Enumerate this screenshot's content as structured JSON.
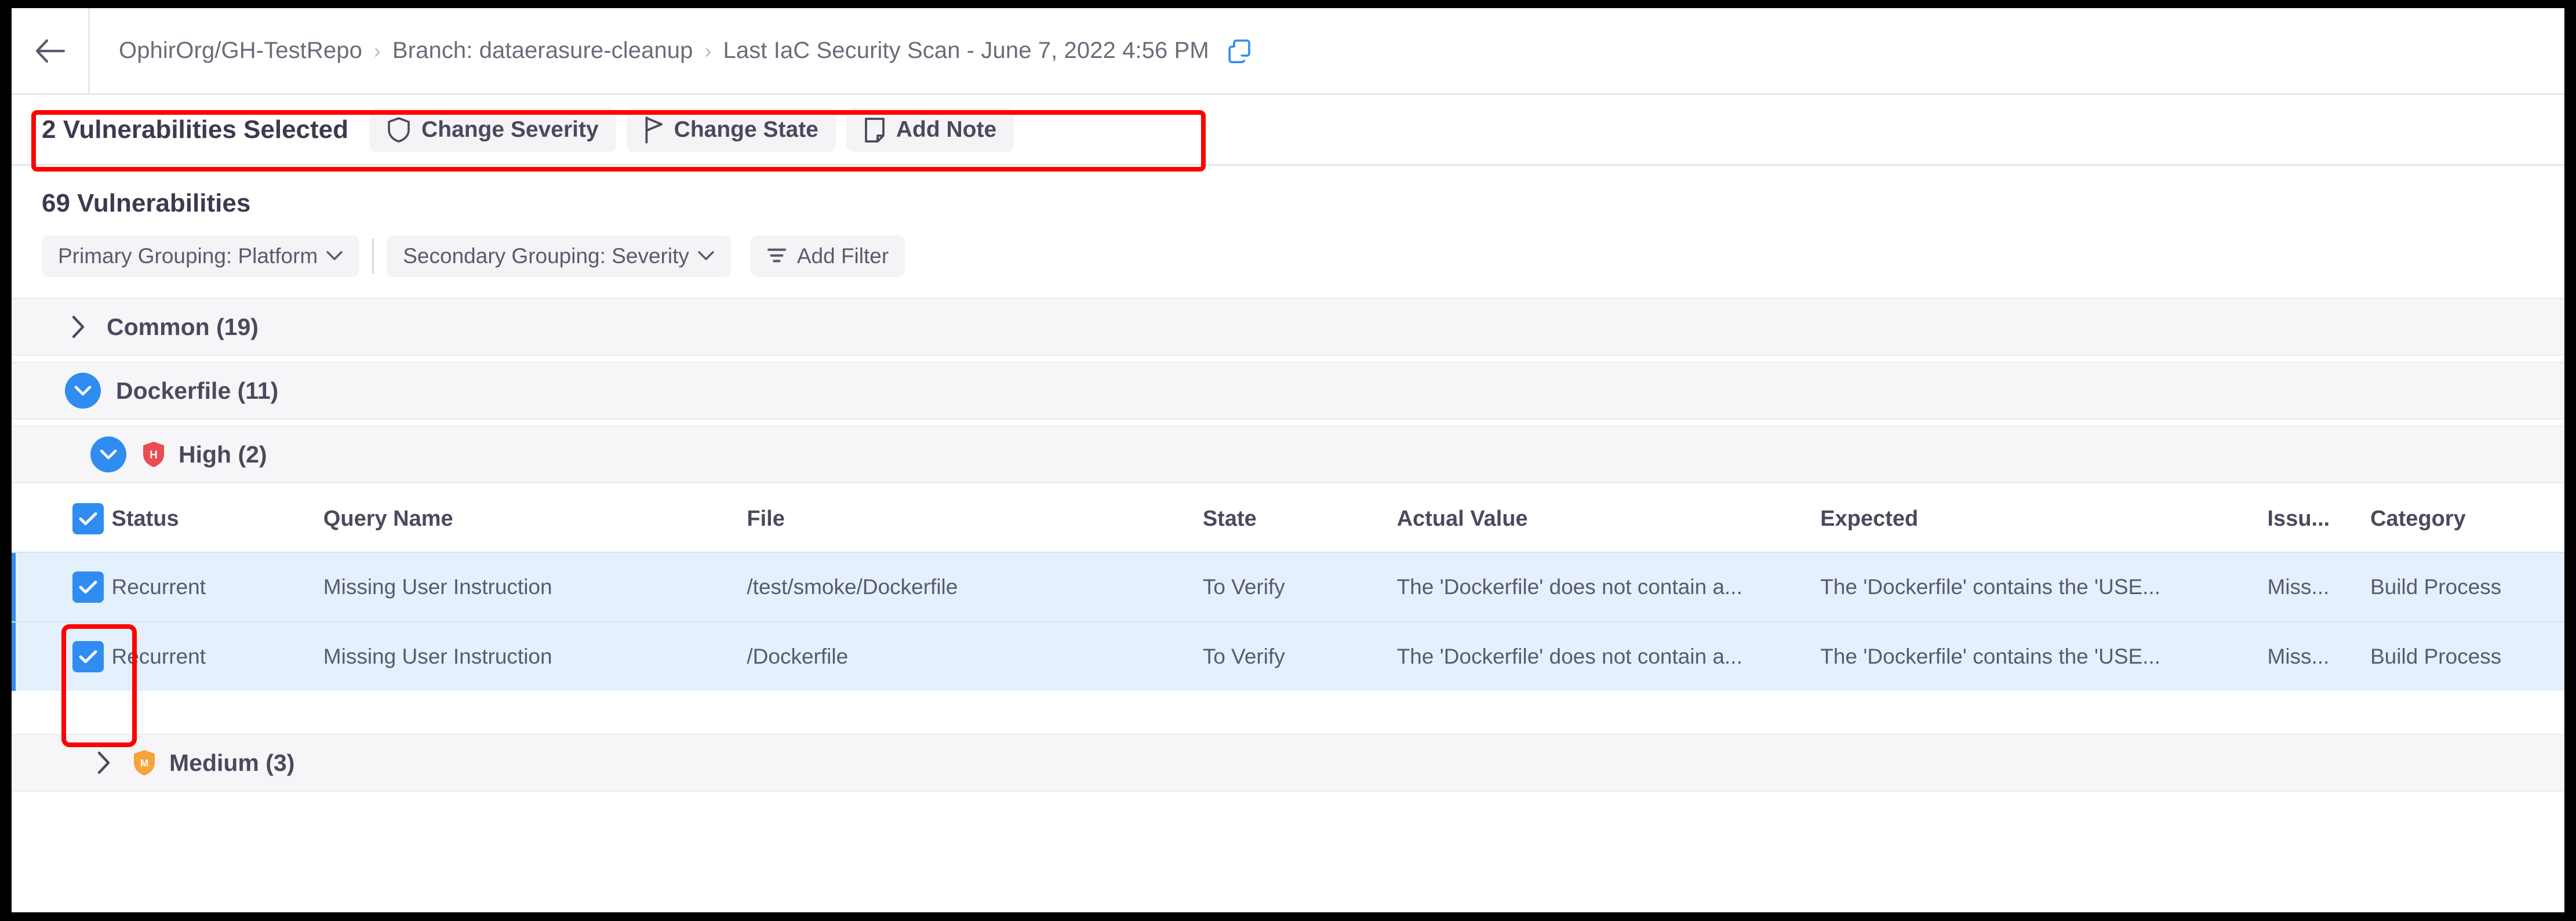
{
  "breadcrumb": {
    "back_icon": "arrow-left-icon",
    "items": [
      {
        "label": "OphirOrg/GH-TestRepo"
      },
      {
        "label": "Branch: dataerasure-cleanup"
      },
      {
        "label": "Last IaC Security Scan - June 7, 2022 4:56 PM"
      }
    ],
    "separator": "›",
    "copy_icon": "copy-icon"
  },
  "action_bar": {
    "selection_count_label": "2 Vulnerabilities Selected",
    "buttons": [
      {
        "label": "Change Severity",
        "icon": "shield-icon"
      },
      {
        "label": "Change State",
        "icon": "flag-icon"
      },
      {
        "label": "Add Note",
        "icon": "note-icon"
      }
    ]
  },
  "list_header": {
    "count_label": "69 Vulnerabilities",
    "primary_grouping": "Primary Grouping: Platform",
    "secondary_grouping": "Secondary Grouping: Severity",
    "add_filter": "Add Filter",
    "chevron": "⌄"
  },
  "groups": [
    {
      "label": "Common (19)",
      "expanded": false
    },
    {
      "label": "Dockerfile (11)",
      "expanded": true
    }
  ],
  "severity_groups": [
    {
      "label": "High (2)",
      "severity": "High",
      "letter": "H",
      "color": "#ea4c53",
      "expanded": true
    },
    {
      "label": "Medium (3)",
      "severity": "Medium",
      "letter": "M",
      "color": "#f5a33c",
      "expanded": false
    }
  ],
  "table": {
    "columns": [
      "Status",
      "Query Name",
      "File",
      "State",
      "Actual Value",
      "Expected",
      "Issu...",
      "Category"
    ],
    "select_all_checked": true,
    "rows": [
      {
        "checked": true,
        "status": "Recurrent",
        "query_name": "Missing User Instruction",
        "file": "/test/smoke/Dockerfile",
        "state": "To Verify",
        "actual_value": "The 'Dockerfile' does not contain a...",
        "expected": "The 'Dockerfile' contains the 'USE...",
        "issue": "Miss...",
        "category": "Build Process"
      },
      {
        "checked": true,
        "status": "Recurrent",
        "query_name": "Missing User Instruction",
        "file": "/Dockerfile",
        "state": "To Verify",
        "actual_value": "The 'Dockerfile' does not contain a...",
        "expected": "The 'Dockerfile' contains the 'USE...",
        "issue": "Miss...",
        "category": "Build Process"
      }
    ]
  },
  "colors": {
    "accent_blue": "#2f8cf0",
    "selected_row_bg": "#e4f0fb",
    "high_severity": "#ea4c53",
    "medium_severity": "#f5a33c",
    "annotation_red": "#ff0000"
  }
}
